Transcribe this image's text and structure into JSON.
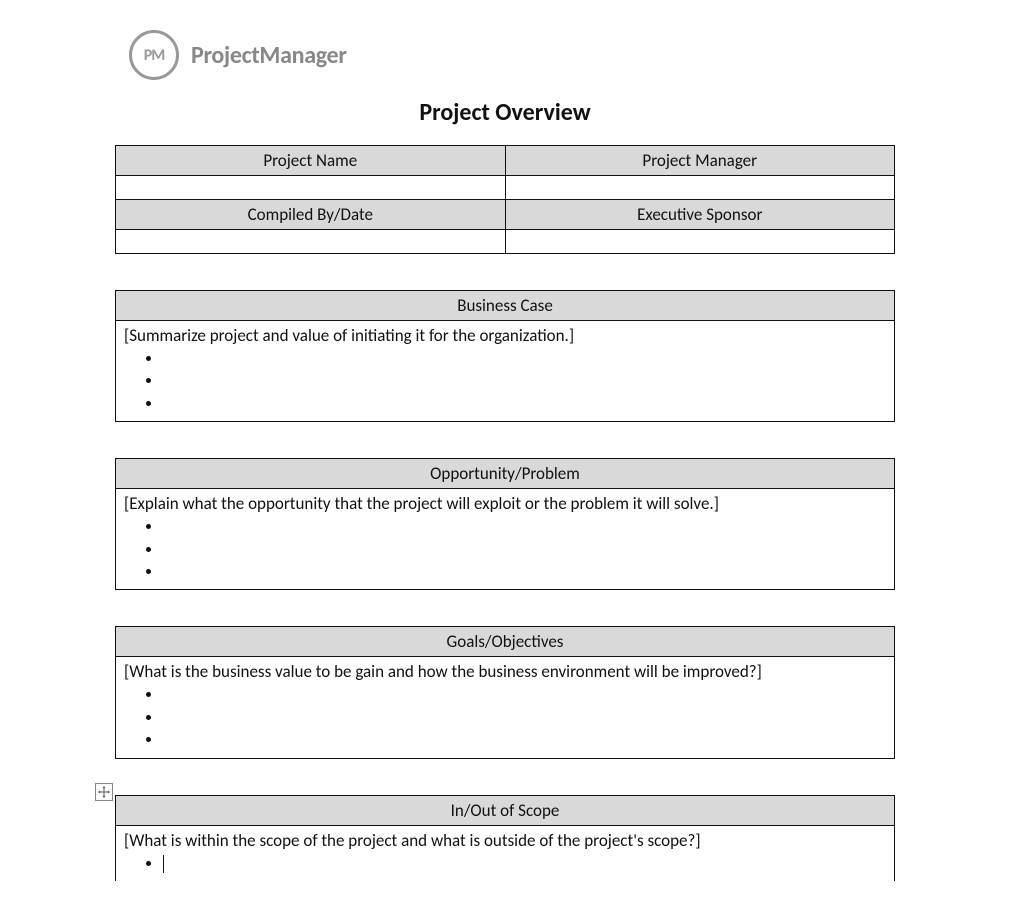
{
  "logo": {
    "abbr": "PM",
    "text": "ProjectManager"
  },
  "title": "Project Overview",
  "meta_table": {
    "headers_row1": [
      "Project Name",
      "Project Manager"
    ],
    "headers_row2": [
      "Compiled By/Date",
      "Executive Sponsor"
    ]
  },
  "sections": [
    {
      "heading": "Business Case",
      "placeholder": "[Summarize project and value of initiating it for the organization.]",
      "bullets": [
        "",
        "",
        ""
      ]
    },
    {
      "heading": "Opportunity/Problem",
      "placeholder": "[Explain what the opportunity that the project will exploit or the problem it will solve.]",
      "bullets": [
        "",
        "",
        ""
      ]
    },
    {
      "heading": "Goals/Objectives",
      "placeholder": "[What is the business value to be gain and how the business environment will be improved?]",
      "bullets": [
        "",
        "",
        ""
      ]
    },
    {
      "heading": "In/Out of Scope",
      "placeholder": "[What is within the scope of the project and what is outside of the project's scope?]",
      "bullets": [
        ""
      ]
    }
  ]
}
